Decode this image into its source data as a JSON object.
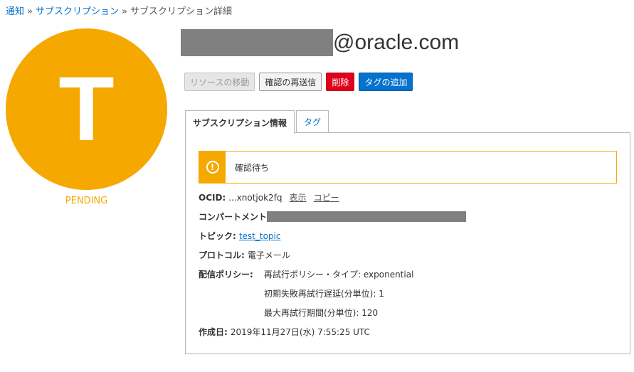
{
  "breadcrumb": {
    "items": [
      "通知",
      "サブスクリプション"
    ],
    "separator": "»",
    "current": "サブスクリプション詳細"
  },
  "avatar": {
    "letter": "T",
    "color": "#f5a800"
  },
  "status": "PENDING",
  "title": {
    "suffix": "@oracle.com"
  },
  "actions": {
    "move": "リソースの移動",
    "resend": "確認の再送信",
    "delete": "削除",
    "add_tags": "タグの追加"
  },
  "tabs": [
    "サブスクリプション情報",
    "タグ"
  ],
  "alert": {
    "message": "確認待ち",
    "icon": "exclamation-circle-icon"
  },
  "details": {
    "ocid_label": "OCID:",
    "ocid_value": "...xnotjok2fq",
    "ocid_show": "表示",
    "ocid_copy": "コピー",
    "compartment_label": "コンパートメント",
    "topic_label": "トピック:",
    "topic_value": "test_topic",
    "protocol_label": "プロトコル:",
    "protocol_value": "電子メール",
    "policy_label": "配信ポリシー:",
    "policy_lines": [
      "再試行ポリシー・タイプ: exponential",
      "初期失敗再試行遅延(分単位): 1",
      "最大再試行期間(分単位): 120"
    ],
    "created_label": "作成日:",
    "created_value": "2019年11月27日(水) 7:55:25 UTC"
  }
}
